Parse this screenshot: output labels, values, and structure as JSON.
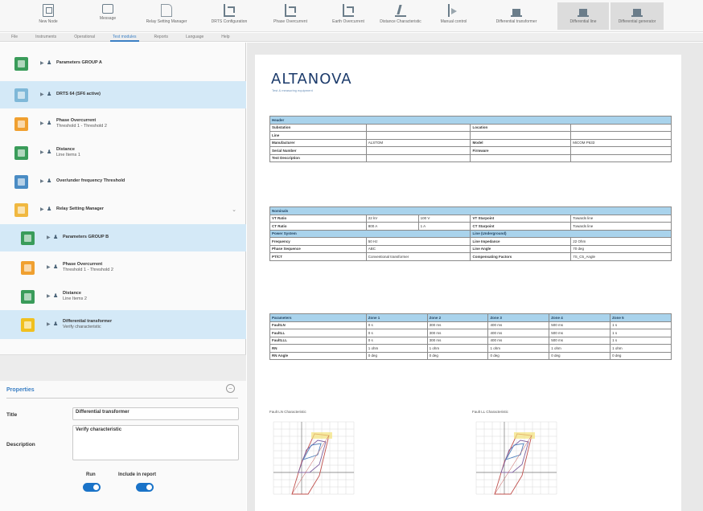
{
  "ribbon": [
    {
      "label": "New Node",
      "icon": "grid-icon"
    },
    {
      "label": "Message",
      "icon": "message-icon"
    },
    {
      "label": "Relay Setting Manager",
      "icon": "document-icon"
    },
    {
      "label": "DRTS Configuration",
      "icon": "graph-icon"
    },
    {
      "label": "Phase Overcurrent",
      "icon": "graph-icon"
    },
    {
      "label": "Earth Overcurrent",
      "icon": "graph-icon"
    },
    {
      "label": "Distance Characteristic",
      "icon": "wave-icon"
    },
    {
      "label": "Manual control",
      "icon": "triangle-icon"
    },
    {
      "label": "Differential transformer",
      "icon": "bar-icon"
    },
    {
      "label": "Differential line",
      "icon": "bar-icon"
    },
    {
      "label": "Differential generator",
      "icon": "bar-icon"
    }
  ],
  "tabs": [
    "File",
    "Instruments",
    "Operational",
    "Test modules",
    "Reports",
    "Language",
    "Help"
  ],
  "active_tab": "Test modules",
  "tree": [
    {
      "label": "Parameters GROUP A",
      "sub": "",
      "color": "#3a9c5a"
    },
    {
      "label": "DRTS 64 (SF6 active)",
      "sub": "",
      "color": "#7fb8d8"
    },
    {
      "label": "Phase Overcurrent",
      "sub": "Threshold 1 - Threshold 2",
      "color": "#f0a030"
    },
    {
      "label": "Distance",
      "sub": "Line Items 1",
      "color": "#3a9c5a"
    },
    {
      "label": "Over/under frequency Threshold",
      "sub": "",
      "color": "#4a8cc4"
    },
    {
      "label": "Relay Setting Manager",
      "sub": "",
      "color": "#f0b840"
    },
    {
      "label": "Parameters GROUP B",
      "sub": "",
      "color": "#3a9c5a"
    },
    {
      "label": "Phase Overcurrent",
      "sub": "Threshold 1 - Threshold 2",
      "color": "#f0a030"
    },
    {
      "label": "Distance",
      "sub": "Line Items 2",
      "color": "#3a9c5a"
    },
    {
      "label": "Differential transformer",
      "sub": "Verify characteristic",
      "color": "#f0c020"
    }
  ],
  "properties": {
    "title": "Properties",
    "title_label": "Title",
    "title_value": "Differential transformer",
    "description_label": "Description",
    "description_value": "Verify characteristic",
    "run_label": "Run",
    "include_label": "Include in report"
  },
  "report": {
    "logo": "ALTANOVA",
    "logo_sub": "Test & measuring equipment",
    "header_title": "Header",
    "header_rows": [
      [
        "Substation",
        "",
        "Location",
        ""
      ],
      [
        "Line",
        "",
        "",
        ""
      ],
      [
        "Manufacturer",
        "ALSTOM",
        "Model",
        "MiCOM P633"
      ],
      [
        "Serial Number",
        "",
        "Firmware",
        ""
      ],
      [
        "Test Description",
        "",
        "",
        ""
      ]
    ],
    "nominals_title": "Nominals",
    "nominal_rows": [
      [
        "VT Ratio",
        "22 kV",
        "100 V",
        "VT Starpoint",
        "Towards line"
      ],
      [
        "CT Ratio",
        "800 A",
        "1 A",
        "CT Starpoint",
        "Towards line"
      ]
    ],
    "power_title": "Power System",
    "line_title": "Line (Underground)",
    "power_rows": [
      [
        "Frequency",
        "50 Hz",
        "Line Impedance",
        "22 Ohm"
      ],
      [
        "Phase Sequence",
        "ABC",
        "Line Angle",
        "70 deg"
      ],
      [
        "PT/CT",
        "Conventional transformer",
        "Compensating Factors",
        "7S_C5_Angle"
      ]
    ],
    "param_headers": [
      "Parameters",
      "Zone 1",
      "Zone 2",
      "Zone 3",
      "Zone 4",
      "Zone 5"
    ],
    "param_rows": [
      [
        "FaultLN",
        "0 s",
        "300 ms",
        "400 ms",
        "500 ms",
        "1 s"
      ],
      [
        "FaultLL",
        "0 s",
        "300 ms",
        "400 ms",
        "500 ms",
        "1 s"
      ],
      [
        "FaultLLL",
        "0 s",
        "300 ms",
        "400 ms",
        "500 ms",
        "1 s"
      ],
      [
        "RN",
        "1 ohm",
        "1 ohm",
        "1 ohm",
        "1 ohm",
        "1 ohm"
      ],
      [
        "RN Angle",
        "0 deg",
        "0 deg",
        "0 deg",
        "0 deg",
        "0 deg"
      ]
    ],
    "chart1_title": "Fault LN Characteristic",
    "chart2_title": "Fault LL Characteristic"
  },
  "colors": {
    "accent": "#3b7fc4",
    "selection": "#d4e9f7",
    "table_header": "#a9d3ec",
    "toggle": "#1a73c8",
    "logo": "#1c3b6b"
  }
}
